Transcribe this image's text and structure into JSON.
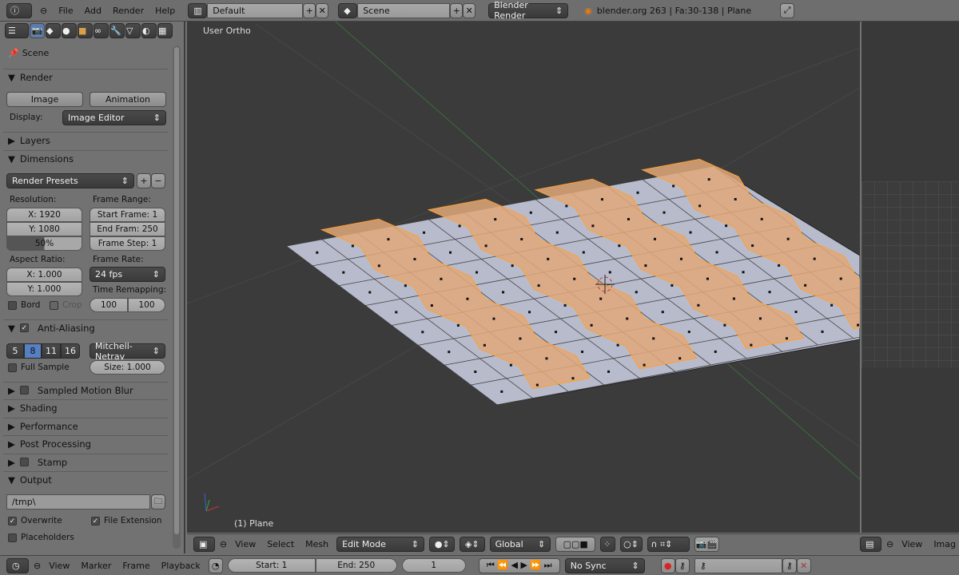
{
  "topbar": {
    "menus": [
      "File",
      "Add",
      "Render",
      "Help"
    ],
    "layout": "Default",
    "scene": "Scene",
    "engine": "Blender Render",
    "info": "blender.org 263 | Fa:30-138 | Plane"
  },
  "properties": {
    "context": "Scene",
    "render": {
      "title": "Render",
      "image": "Image",
      "animation": "Animation",
      "display_label": "Display:",
      "display_value": "Image Editor"
    },
    "layers": "Layers",
    "dimensions": {
      "title": "Dimensions",
      "presets": "Render Presets",
      "resolution_label": "Resolution:",
      "res_x": "X: 1920",
      "res_y": "Y: 1080",
      "res_pct": "50%",
      "res_pct_value": 0.5,
      "frame_range_label": "Frame Range:",
      "start": "Start Frame: 1",
      "end": "End Fram: 250",
      "step": "Frame Step: 1",
      "aspect_label": "Aspect Ratio:",
      "asp_x": "X: 1.000",
      "asp_y": "Y: 1.000",
      "frame_rate_label": "Frame Rate:",
      "fps": "24 fps",
      "remap_label": "Time Remapping:",
      "remap_old": "100",
      "remap_new": "100",
      "bord": "Bord",
      "crop": "Crop"
    },
    "aa": {
      "title": "Anti-Aliasing",
      "samples": [
        "5",
        "8",
        "11",
        "16"
      ],
      "selected": "8",
      "filter": "Mitchell-Netrav",
      "full_sample": "Full Sample",
      "size": "Size: 1.000"
    },
    "panels": [
      "Sampled Motion Blur",
      "Shading",
      "Performance",
      "Post Processing",
      "Stamp"
    ],
    "output": {
      "title": "Output",
      "path": "/tmp\\",
      "overwrite": "Overwrite",
      "file_ext": "File Extension",
      "placeholders": "Placeholders"
    }
  },
  "viewport": {
    "view_name": "User Ortho",
    "object": "(1) Plane",
    "colors": {
      "bg": "#3b3b3b",
      "face": "#b9bccb",
      "selected": "#e0a87a",
      "edge_sel": "#ffa030"
    }
  },
  "header3d": {
    "menus": [
      "View",
      "Select",
      "Mesh"
    ],
    "mode": "Edit Mode",
    "orientation": "Global",
    "image_menus": [
      "View",
      "Imag"
    ]
  },
  "timeline": {
    "menus": [
      "View",
      "Marker",
      "Frame",
      "Playback"
    ],
    "start": "Start: 1",
    "end": "End: 250",
    "current": "1",
    "sync": "No Sync"
  }
}
